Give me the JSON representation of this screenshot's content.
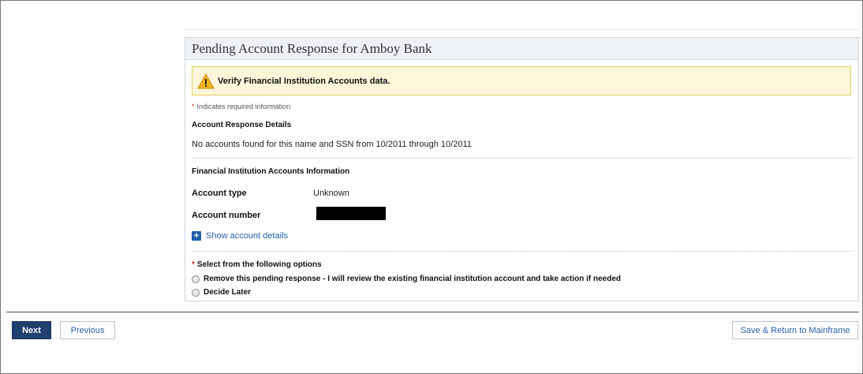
{
  "panel": {
    "title": "Pending Account Response for Amboy Bank"
  },
  "alert": {
    "icon": "warning-icon",
    "text": "Verify Financial Institution Accounts data."
  },
  "required_note": {
    "star": "*",
    "text": "Indicates required information"
  },
  "response_details": {
    "heading": "Account Response Details",
    "message": "No accounts found for this name and SSN from 10/2011 through 10/2011"
  },
  "accounts_info": {
    "heading": "Financial Institution Accounts Information",
    "account_type_label": "Account type",
    "account_type_value": "Unknown",
    "account_number_label": "Account number"
  },
  "show_details": {
    "icon": "plus-icon",
    "label": "Show account details"
  },
  "options": {
    "star": "*",
    "title": "Select from the following options",
    "items": [
      "Remove this pending response - I will review the existing financial institution account and take action if needed",
      "Decide Later"
    ]
  },
  "footer": {
    "next_label": "Next",
    "previous_label": "Previous",
    "save_label": "Save & Return to Mainframe"
  },
  "colors": {
    "accent": "#1f3f6e",
    "link": "#2561a8",
    "alert_bg": "#fdf6d8",
    "alert_border": "#e7cf63",
    "required": "#c0392b"
  }
}
